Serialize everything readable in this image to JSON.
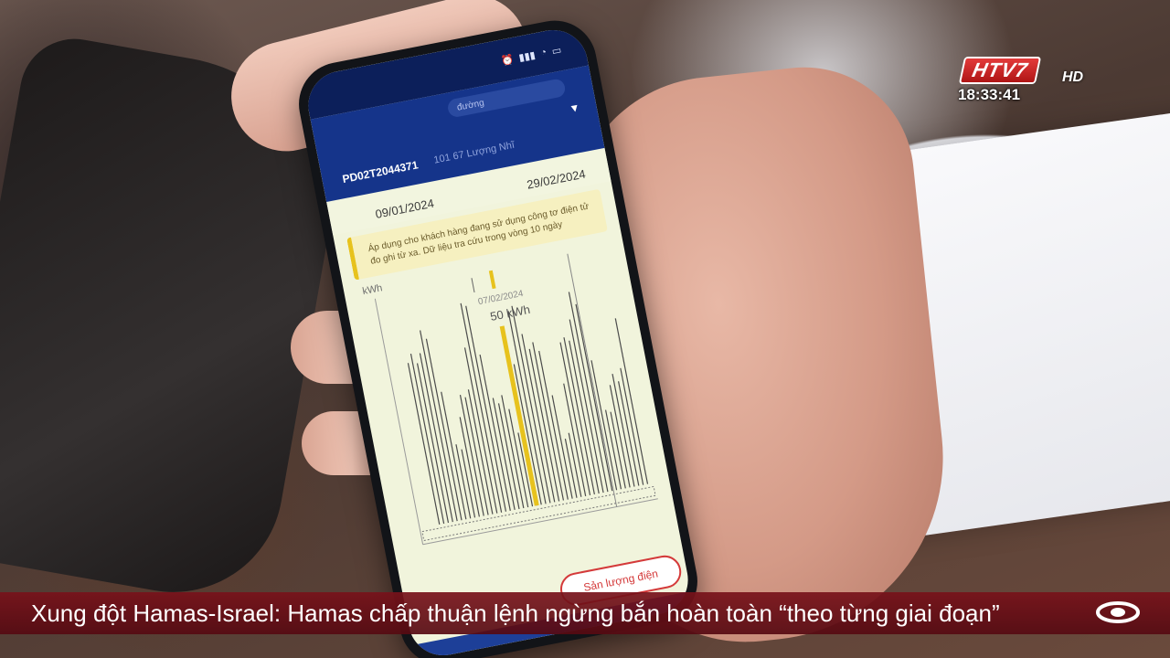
{
  "overlay": {
    "channel_logo": "HTV7",
    "channel_hd": "HD",
    "clock": "18:33:41",
    "ticker": "Xung đột Hamas-Israel: Hamas chấp thuận lệnh ngừng bắn hoàn toàn “theo từng giai đoạn”",
    "channel_mark_icon": "htv-ring-logo-icon"
  },
  "phone_app": {
    "tab_label": "đường",
    "account_id": "PD02T2044371",
    "account_sub": "101 67 Lượng Nhĩ",
    "date_from": "09/01/2024",
    "date_to": "29/02/2024",
    "notice": "Áp dụng cho khách hàng đang sử dụng công tơ điện tử đo ghi từ xa. Dữ liệu tra cứu trong vòng 10 ngày",
    "unit": "kWh",
    "tooltip_date": "07/02/2024",
    "tooltip_value": "50 kWh",
    "button_label": "Sản lượng điện"
  },
  "colors": {
    "accent": "#e7c21d",
    "header": "#15348a",
    "ticker": "#7a1220",
    "button": "#d43a3a"
  }
}
